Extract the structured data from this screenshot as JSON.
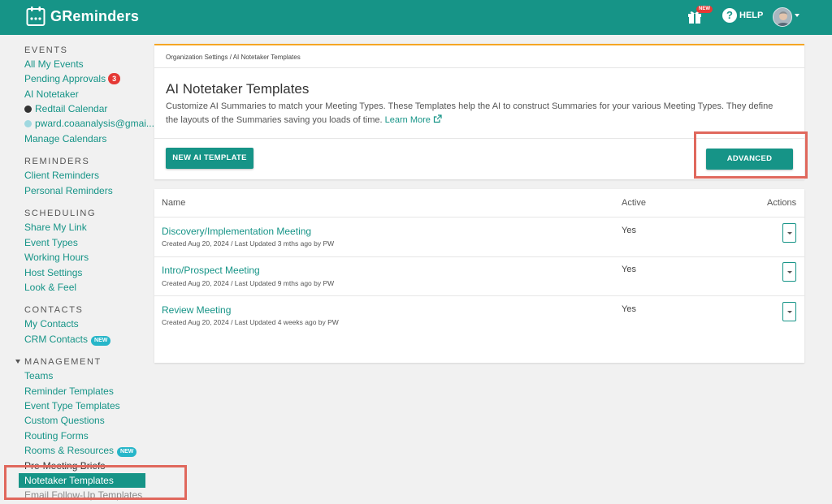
{
  "header": {
    "app_name": "GReminders",
    "gift_badge": "NEW",
    "help_label": "HELP"
  },
  "sidebar": {
    "events": {
      "title": "EVENTS",
      "items": [
        {
          "label": "All My Events"
        },
        {
          "label": "Pending Approvals",
          "badge": "3"
        },
        {
          "label": "AI Notetaker"
        },
        {
          "label": "Redtail Calendar"
        },
        {
          "label": "pward.coaanalysis@gmai..."
        },
        {
          "label": "Manage Calendars"
        }
      ]
    },
    "reminders": {
      "title": "REMINDERS",
      "items": [
        {
          "label": "Client Reminders"
        },
        {
          "label": "Personal Reminders"
        }
      ]
    },
    "scheduling": {
      "title": "SCHEDULING",
      "items": [
        {
          "label": "Share My Link"
        },
        {
          "label": "Event Types"
        },
        {
          "label": "Working Hours"
        },
        {
          "label": "Host Settings"
        },
        {
          "label": "Look & Feel"
        }
      ]
    },
    "contacts": {
      "title": "CONTACTS",
      "items": [
        {
          "label": "My Contacts"
        },
        {
          "label": "CRM Contacts",
          "badge": "NEW"
        }
      ]
    },
    "management": {
      "title": "MANAGEMENT",
      "items": [
        {
          "label": "Teams"
        },
        {
          "label": "Reminder Templates"
        },
        {
          "label": "Event Type Templates"
        },
        {
          "label": "Custom Questions"
        },
        {
          "label": "Routing Forms"
        },
        {
          "label": "Rooms & Resources",
          "badge": "NEW"
        },
        {
          "label": "Pre-Meeting Briefs"
        },
        {
          "label": "Notetaker Templates"
        },
        {
          "label": "Email Follow-Up Templates"
        }
      ]
    }
  },
  "main": {
    "breadcrumb": "Organization Settings / AI Notetaker Templates",
    "title": "AI Notetaker Templates",
    "description": "Customize AI Summaries to match your Meeting Types. These Templates help the AI to construct Summaries for your various Meeting Types. They define the layouts of the Summaries saving you loads of time.",
    "learn_more": "Learn More",
    "new_button": "NEW AI TEMPLATE",
    "advanced_button": "ADVANCED",
    "table": {
      "columns": [
        "Name",
        "Active",
        "Actions"
      ],
      "rows": [
        {
          "name": "Discovery/Implementation Meeting",
          "meta": "Created Aug 20, 2024 / Last Updated 3 mths ago by PW",
          "active": "Yes"
        },
        {
          "name": "Intro/Prospect Meeting",
          "meta": "Created Aug 20, 2024 / Last Updated 9 mths ago by PW",
          "active": "Yes"
        },
        {
          "name": "Review Meeting",
          "meta": "Created Aug 20, 2024 / Last Updated 4 weeks ago by PW",
          "active": "Yes"
        }
      ]
    }
  },
  "colors": {
    "brand": "#169487",
    "card_accent": "#f5a623",
    "highlight": "#e0685d",
    "badge_red": "#e53935",
    "badge_new": "#27b6c9",
    "redtail_dot": "#333333",
    "gmail_dot": "#9fd8e0"
  },
  "icons": [
    "calendar-logo-icon",
    "gift-icon",
    "help-icon",
    "external-link-icon",
    "caret-down-icon",
    "chevron-down-icon"
  ]
}
